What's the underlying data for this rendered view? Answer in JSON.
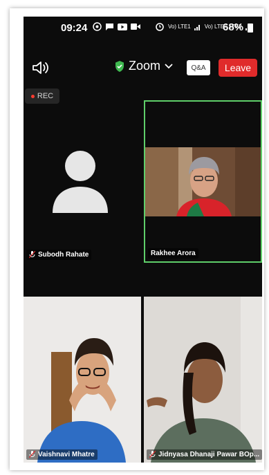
{
  "status_bar": {
    "time": "09:24",
    "network_1": "Vo) LTE1",
    "network_2": "Vo) LTE+ LTE2",
    "battery": "68%"
  },
  "meeting": {
    "title": "Zoom",
    "qa_label": "Q&A",
    "leave_label": "Leave",
    "rec_label": "REC"
  },
  "participants": [
    {
      "name": "Subodh Rahate",
      "video": false
    },
    {
      "name": "Rakhee Arora",
      "video": true,
      "active_speaker": true
    },
    {
      "name": "Vaishnavi Mhatre",
      "video": true
    },
    {
      "name": "Jidnyasa Dhanaji Pawar BOp...",
      "video": true
    }
  ],
  "colors": {
    "background": "#0c0c0c",
    "leave": "#e02b2b",
    "active_border": "#5fcf6a",
    "shield": "#3fb950"
  }
}
